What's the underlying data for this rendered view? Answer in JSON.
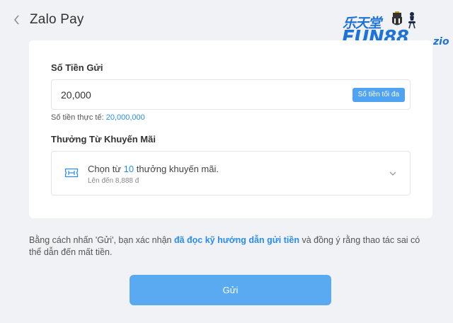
{
  "header": {
    "back_icon": "chevron-left-icon",
    "title": "Zalo Pay"
  },
  "brand": {
    "cn_text": "乐天堂",
    "wordmark": "FUN88",
    "suffix": "zio",
    "color": "#1e73d8"
  },
  "deposit": {
    "amount_label": "Số Tiền Gửi",
    "amount_value": "20,000",
    "max_button_label": "Số tiền tối đa",
    "actual_label": "Số tiền thực tế:",
    "actual_value": "20,000,000"
  },
  "promotion": {
    "section_label": "Thưởng Từ Khuyến Mãi",
    "icon": "ticket-icon",
    "choose_prefix": "Chọn từ",
    "choose_count": "10",
    "choose_suffix": "thưởng khuyến mãi.",
    "subtext": "Lên đến 8,888 đ",
    "chevron_icon": "chevron-down-icon"
  },
  "disclaimer": {
    "before": "Bằng cách nhấn 'Gửi', bạn xác nhận",
    "link": "đã đọc kỹ hướng dẫn gửi tiền",
    "after": "và đồng ý rằng thao tác sai có thể dẫn đến mất tiền."
  },
  "submit": {
    "label": "Gửi"
  },
  "colors": {
    "accent": "#2a8cf0",
    "button": "#5aaaf2",
    "background": "#f1f2f6"
  }
}
